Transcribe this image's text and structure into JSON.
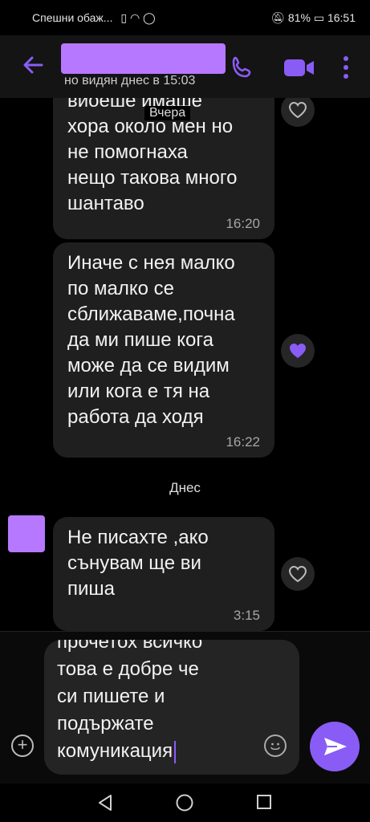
{
  "status_bar": {
    "carrier": "Спешни обаж...",
    "battery": "81%",
    "time": "16:51"
  },
  "header": {
    "last_seen": "но видян днес в 15:03"
  },
  "chat": {
    "floating_date": "Вчера",
    "messages": [
      {
        "lines": [
          "виоеше имаше",
          "хора около мен но",
          "не помогнаха",
          "нещо такова много",
          "шантаво"
        ],
        "time": "16:20",
        "liked": false
      },
      {
        "lines": [
          "Иначе с нея малко",
          "по малко се",
          "сближаваме,почна",
          "да ми пише кога",
          "може да се видим",
          "или кога е тя на",
          "работа да ходя"
        ],
        "time": "16:22",
        "liked": true
      },
      {
        "lines": [
          "Не писахте ,ако",
          "сънувам ще ви",
          "пиша"
        ],
        "time": "3:15",
        "liked": false
      }
    ],
    "today_label": "Днес"
  },
  "composer": {
    "cut_line": "прочетох всичко",
    "lines": [
      "това е добре че",
      "си пишете и",
      "подържате",
      "комуникация"
    ]
  },
  "colors": {
    "accent": "#8a5cf6",
    "redaction": "#b678ff",
    "bubble": "#1f1f1f"
  }
}
